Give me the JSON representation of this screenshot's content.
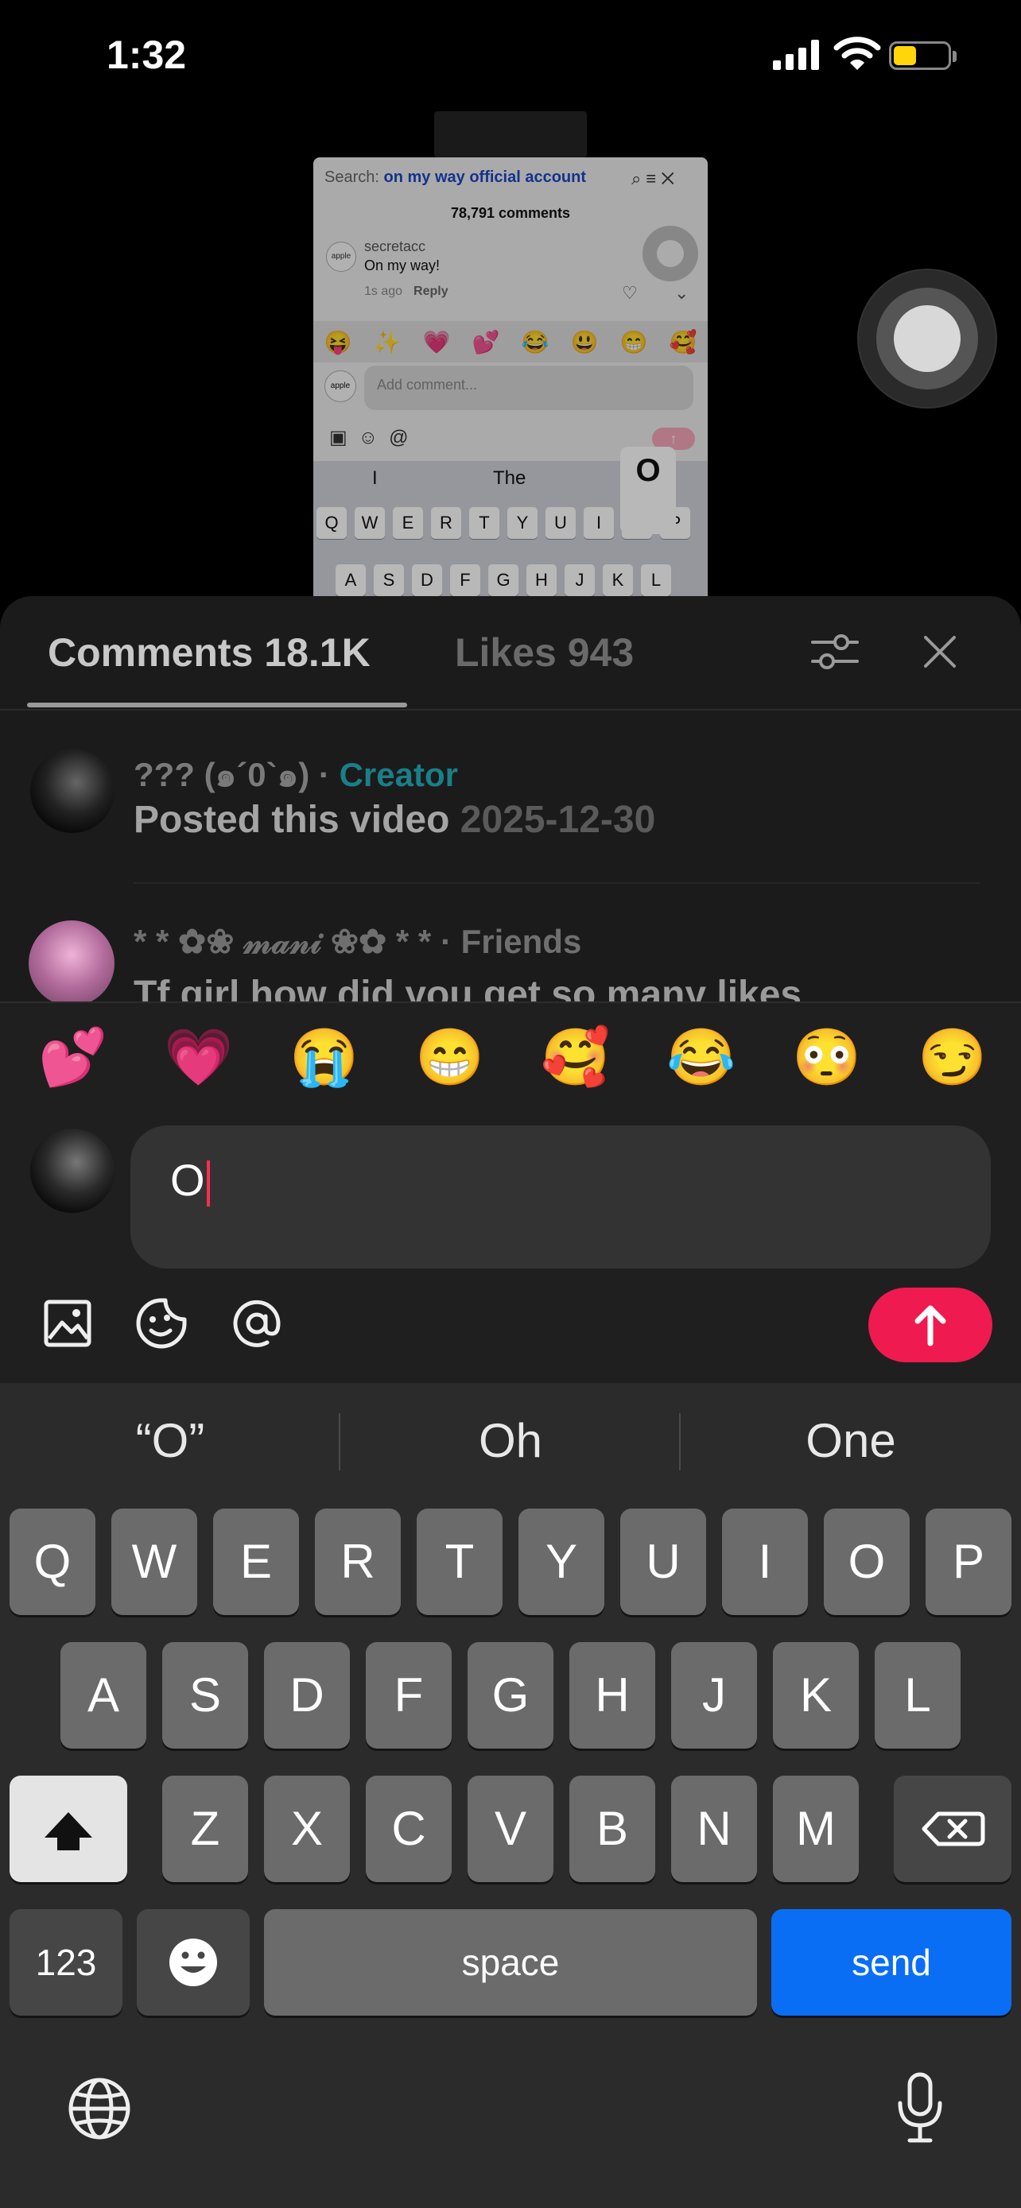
{
  "status_bar": {
    "time": "1:32"
  },
  "preview": {
    "search_prefix": "Search:",
    "search_query": "on my way official account",
    "comment_count": "78,791 comments",
    "avatar_text": "apple",
    "username": "secretacc",
    "comment": "On my way!",
    "time_ago": "1s ago",
    "reply": "Reply",
    "emojis": [
      "😝",
      "✨",
      "💗",
      "💕",
      "😂",
      "😃",
      "😁",
      "🥰"
    ],
    "input_placeholder": "Add comment...",
    "suggestions": [
      "I",
      "The"
    ],
    "key_popup": "O",
    "row1": [
      "Q",
      "W",
      "E",
      "R",
      "T",
      "Y",
      "U",
      "I",
      "O",
      "P"
    ],
    "row2": [
      "A",
      "S",
      "D",
      "F",
      "G",
      "H",
      "J",
      "K",
      "L"
    ]
  },
  "tabs": {
    "comments": "Comments 18.1K",
    "likes": "Likes 943"
  },
  "comments": [
    {
      "name": "??? (๑´0`๑)",
      "separator": " · ",
      "badge": "Creator",
      "text": "Posted this video",
      "date": "2025-12-30"
    },
    {
      "name": "* * ✿❀ 𝓂𝒶𝓃𝒾 ❀✿ * *",
      "separator": " · ",
      "badge": "Friends",
      "text": "Tf girl how did you get so many likes"
    }
  ],
  "quick_emojis": [
    "💕",
    "💗",
    "😭",
    "😁",
    "🥰",
    "😂",
    "😳",
    "😏"
  ],
  "composer": {
    "value": "O"
  },
  "colors": {
    "send": "#ef1a4f",
    "creator": "#1b7e88",
    "keyboard_send": "#0a6ef5"
  },
  "keyboard": {
    "suggestions": [
      "“O”",
      "Oh",
      "One"
    ],
    "row1": [
      "Q",
      "W",
      "E",
      "R",
      "T",
      "Y",
      "U",
      "I",
      "O",
      "P"
    ],
    "row2": [
      "A",
      "S",
      "D",
      "F",
      "G",
      "H",
      "J",
      "K",
      "L"
    ],
    "row3": [
      "Z",
      "X",
      "C",
      "V",
      "B",
      "N",
      "M"
    ],
    "numbers": "123",
    "space": "space",
    "send": "send"
  }
}
